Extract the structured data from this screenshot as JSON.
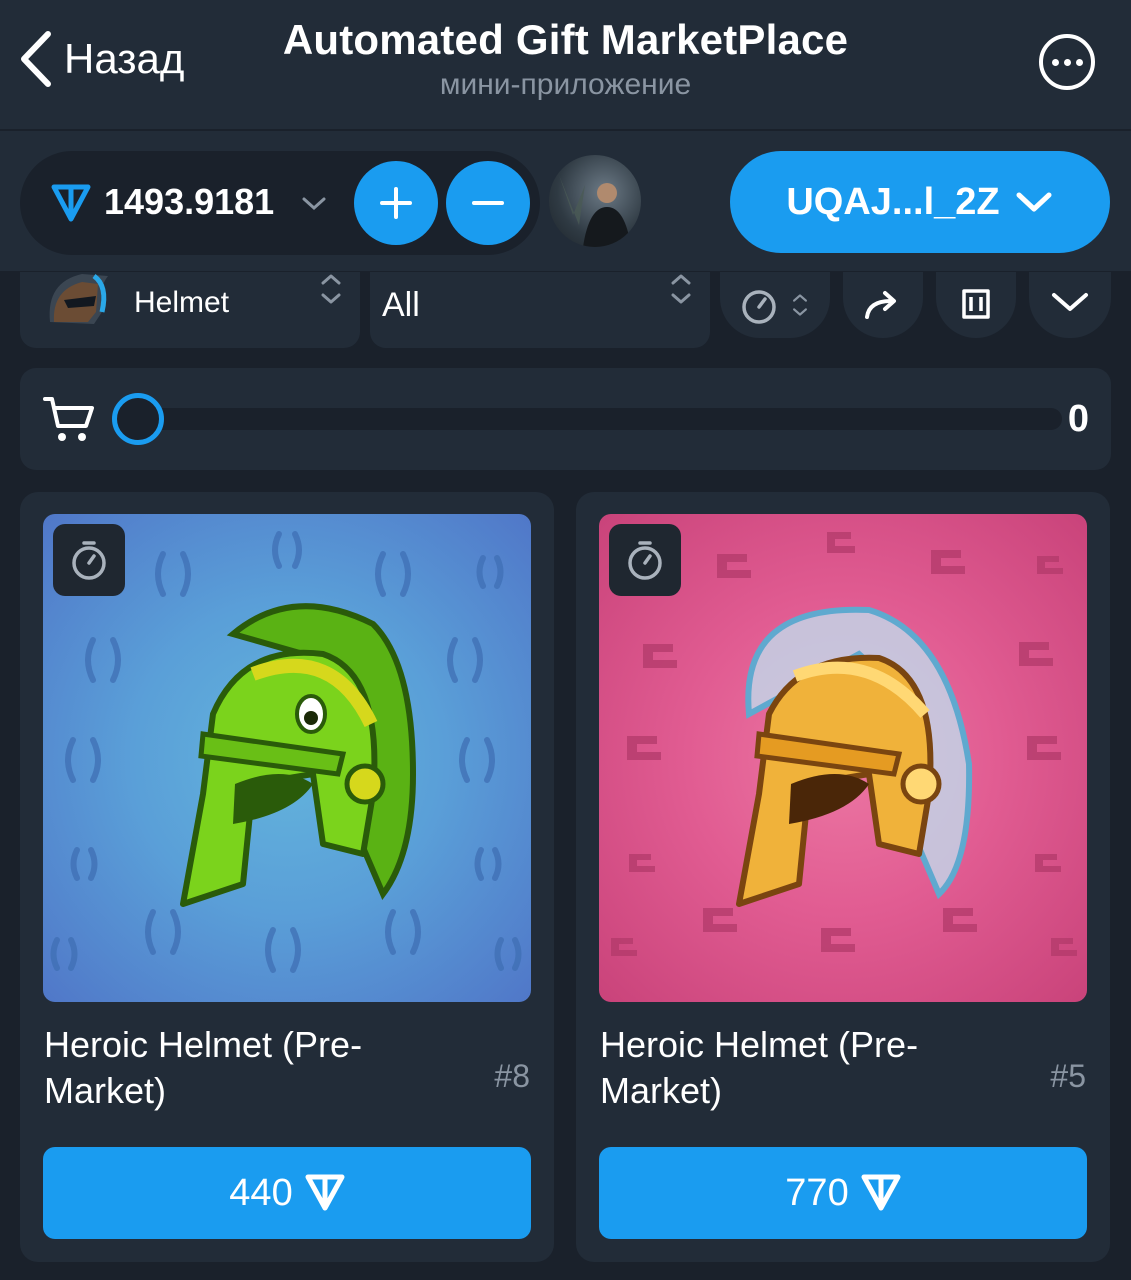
{
  "header": {
    "back_label": "Назад",
    "title": "Automated Gift MarketPlace",
    "subtitle": "мини-приложение"
  },
  "wallet": {
    "balance": "1493.9181",
    "address": "UQAJ...l_2Z"
  },
  "filters": {
    "gift_label": "Helmet",
    "model_label": "All"
  },
  "cart": {
    "count": "0",
    "progress": 0
  },
  "gifts": [
    {
      "name": "Heroic Helmet (Pre-Market)",
      "number": "#8",
      "price": "440",
      "background": "#5a9fd8"
    },
    {
      "name": "Heroic Helmet (Pre-Market)",
      "number": "#5",
      "price": "770",
      "background": "#e15c92"
    }
  ],
  "colors": {
    "accent": "#1a9cf0",
    "panel": "#222c38",
    "page": "#1a212b"
  },
  "icons": {
    "back": "chevron-left-icon",
    "more": "more-dots-icon",
    "currency": "ton-icon",
    "cart": "cart-icon",
    "timer": "stopwatch-icon",
    "share": "share-arrow-icon",
    "delete": "trash-icon",
    "collapse": "chevron-down-icon"
  }
}
